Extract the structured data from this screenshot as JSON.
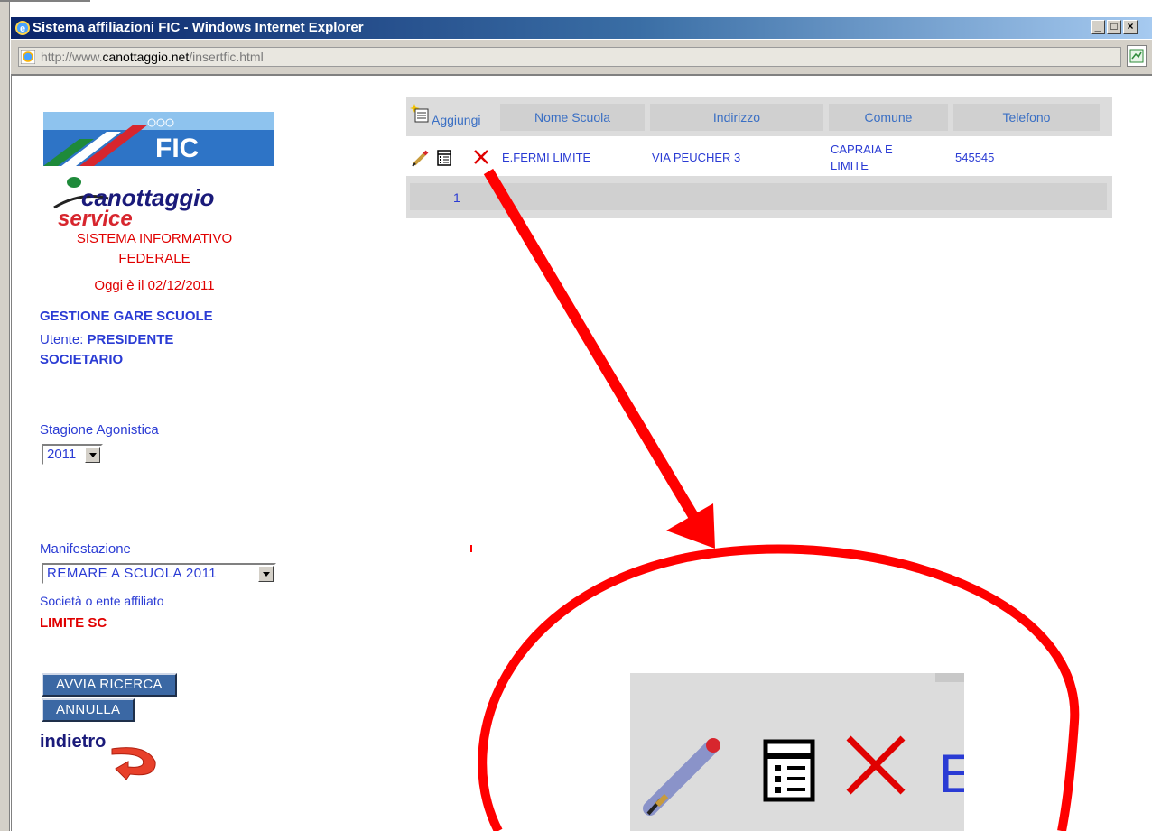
{
  "window": {
    "title": "Sistema affiliazioni FIC - Windows Internet Explorer",
    "url_prefix": "http://www.",
    "url_domain": "canottaggio.net",
    "url_suffix": "/insertfic.html",
    "minimize": "_",
    "maximize": "□",
    "close": "×"
  },
  "sidebar": {
    "fic_logo": "FIC",
    "cs_logo_line1": "canottaggio",
    "cs_logo_line2": "service",
    "system_line1": "SISTEMA INFORMATIVO",
    "system_line2": "FEDERALE",
    "today": "Oggi è il 02/12/2011",
    "gestione": "GESTIONE GARE SCUOLE",
    "utente_label": "Utente: ",
    "utente_value1": "PRESIDENTE",
    "utente_value2": "SOCIETARIO",
    "stagione_label": "Stagione Agonistica",
    "stagione_value": "2011",
    "manifestazione_label": "Manifestazione",
    "manifestazione_value": "REMARE A SCUOLA 2011",
    "societa_label": "Società o ente affiliato",
    "societa_value": "LIMITE SC",
    "avvia_button": "AVVIA RICERCA",
    "annulla_button": "ANNULLA",
    "indietro": "indietro"
  },
  "table": {
    "add_label": "Aggiungi",
    "columns": [
      "Nome Scuola",
      "Indirizzo",
      "Comune",
      "Telefono"
    ],
    "rows": [
      {
        "nome": "E.FERMI LIMITE",
        "indirizzo": "VIA PEUCHER 3",
        "comune_line1": "CAPRAIA E",
        "comune_line2": "LIMITE",
        "telefono": "545545"
      }
    ],
    "page": "1"
  },
  "zoom": {
    "partial_text": "E",
    "icons": [
      "pencil-icon",
      "details-icon",
      "delete-icon"
    ]
  },
  "colors": {
    "annotation": "#ff0000",
    "link": "#2a3bd4",
    "header_text": "#3a6fc4",
    "button_bg": "#3b68a4"
  }
}
